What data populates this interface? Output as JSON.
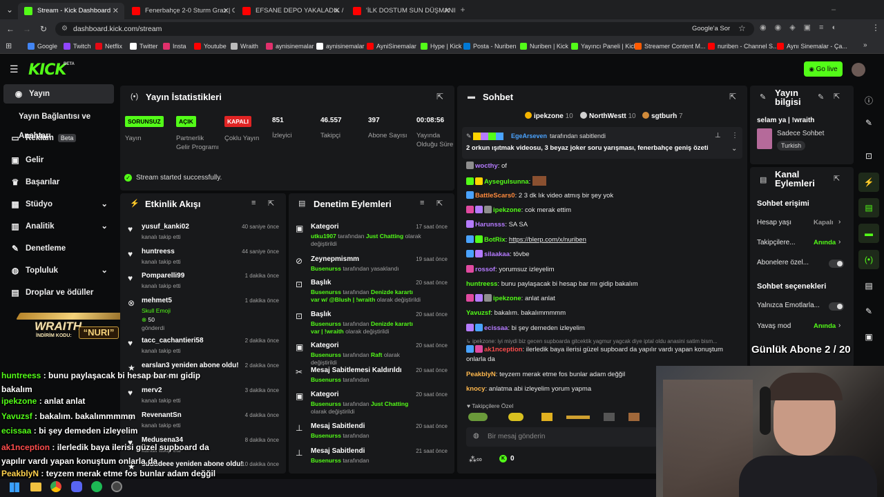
{
  "browser": {
    "tabs": [
      {
        "title": "Stream - Kick Dashboard",
        "fav": "#53fc18",
        "active": true
      },
      {
        "title": "Fenerbahçe 2-0 Sturm Graz | Gü",
        "fav": "#ff0000"
      },
      {
        "title": "EFSANE DEPO YAKALADIK / ŞT",
        "fav": "#ff0000"
      },
      {
        "title": "'İLK DOSTUM SUN DÜŞMANIM",
        "fav": "#ff0000"
      }
    ],
    "url": "dashboard.kick.com/stream",
    "google_btn": "Google'a Sor",
    "bookmarks": [
      {
        "label": "Google",
        "c": "#4285f4"
      },
      {
        "label": "Twitch",
        "c": "#9146ff"
      },
      {
        "label": "Netflix",
        "c": "#e50914"
      },
      {
        "label": "Twitter",
        "c": "#ffffff"
      },
      {
        "label": "Insta",
        "c": "#e1306c"
      },
      {
        "label": "Youtube",
        "c": "#ff0000"
      },
      {
        "label": "Wraith",
        "c": "#bbbbbb"
      },
      {
        "label": "aynisinemalar",
        "c": "#e1306c"
      },
      {
        "label": "aynisinemalar",
        "c": "#ffffff"
      },
      {
        "label": "AyniSinemalar",
        "c": "#ff0000"
      },
      {
        "label": "Hype | Kick",
        "c": "#53fc18"
      },
      {
        "label": "Posta - Nuriben",
        "c": "#0078d4"
      },
      {
        "label": "Nuriben | Kick",
        "c": "#53fc18"
      },
      {
        "label": "Yayıncı Paneli | Kick",
        "c": "#53fc18"
      },
      {
        "label": "Streamer Content M...",
        "c": "#ff5a00"
      },
      {
        "label": "nuriben - Channel S...",
        "c": "#ff0000"
      },
      {
        "label": "Aynı Sinemalar - Ça...",
        "c": "#ff0000"
      }
    ]
  },
  "kick": {
    "logo": "KICK",
    "beta": "BETA",
    "go_live": "Go live",
    "sidebar": [
      {
        "label": "Yayın",
        "icon": "broadcast-icon",
        "active": true
      },
      {
        "label": "Yayın Bağlantısı ve Anahtarı",
        "icon": ""
      },
      {
        "label": "Reklam",
        "icon": "ad-icon",
        "tag": "Beta"
      },
      {
        "label": "Gelir",
        "icon": "revenue-icon"
      },
      {
        "label": "Başarılar",
        "icon": "trophy-icon"
      },
      {
        "label": "Stüdyo",
        "icon": "studio-icon",
        "chev": true
      },
      {
        "label": "Analitik",
        "icon": "analytics-icon",
        "chev": true
      },
      {
        "label": "Denetleme",
        "icon": "moderation-icon"
      },
      {
        "label": "Topluluk",
        "icon": "community-icon",
        "chev": true
      },
      {
        "label": "Droplar ve ödüller",
        "icon": "drops-icon"
      }
    ],
    "stats": {
      "title": "Yayın İstatistikleri",
      "cells": [
        {
          "pill": "SORUNSUZ",
          "pill_color": "#53fc18",
          "label": "Yayın"
        },
        {
          "pill": "AÇIK",
          "pill_color": "#53fc18",
          "label": "Partnerlik Gelir Programı"
        },
        {
          "pill": "KAPALI",
          "pill_color": "#e02424",
          "label": "Çoklu Yayın"
        },
        {
          "value": "851",
          "label": "İzleyici"
        },
        {
          "value": "46.557",
          "label": "Takipçi"
        },
        {
          "value": "397",
          "label": "Abone Sayısı"
        },
        {
          "value": "00:08:56",
          "label": "Yayında Olduğu Süre"
        }
      ],
      "success": "Stream started successfully."
    },
    "activity": {
      "title": "Etkinlik Akışı",
      "items": [
        {
          "name": "yusuf_kanki02",
          "sub": "kanalı takip etti",
          "time": "40 saniye önce",
          "icon": "heart-icon"
        },
        {
          "name": "huntreess",
          "sub": "kanalı takip etti",
          "time": "44 saniye önce",
          "icon": "heart-icon"
        },
        {
          "name": "Pomparelli99",
          "sub": "kanalı takip etti",
          "time": "1 dakika önce",
          "icon": "heart-icon"
        },
        {
          "name": "mehmet5",
          "sub": "Skull Emoji",
          "sub2": "50",
          "sub3": "gönderdi",
          "time": "1 dakika önce",
          "icon": "kicks-icon"
        },
        {
          "name": "tacc_cachantieri58",
          "sub": "kanalı takip etti",
          "time": "2 dakika önce",
          "icon": "heart-icon"
        },
        {
          "name": "earslan3 yeniden abone oldu!",
          "sub": "3 aydır abone",
          "time": "2 dakika önce",
          "icon": "star-icon"
        },
        {
          "name": "merv2",
          "sub": "kanalı takip etti",
          "time": "3 dakika önce",
          "icon": "heart-icon"
        },
        {
          "name": "RevenantSn",
          "sub": "kanalı takip etti",
          "time": "4 dakika önce",
          "icon": "heart-icon"
        },
        {
          "name": "Medusena34",
          "sub": "kanalı takip etti",
          "time": "8 dakika önce",
          "icon": "heart-icon"
        },
        {
          "name": "suuudeee yeniden abone oldu!",
          "sub": "",
          "time": "10 dakika önce",
          "icon": "star-icon"
        }
      ]
    },
    "moderation": {
      "title": "Denetim Eylemleri",
      "items": [
        {
          "title": "Kategori",
          "user": "utku1907",
          "mid": "tarafından",
          "hl": "Just Chatting",
          "rest": "olarak değiştirildi",
          "time": "17 saat önce",
          "icon": "category-icon"
        },
        {
          "title": "Zeynepmismm",
          "user": "Busenurss",
          "mid": "tarafından yasaklandı",
          "hl": "",
          "rest": "",
          "time": "19 saat önce",
          "icon": "ban-icon"
        },
        {
          "title": "Başlık",
          "user": "Busenurss",
          "mid": "tarafından",
          "hl": "Denizde karartı var w/ @Blush | !wraith",
          "rest": "olarak değiştirildi",
          "time": "20 saat önce",
          "icon": "title-icon"
        },
        {
          "title": "Başlık",
          "user": "Busenurss",
          "mid": "tarafından",
          "hl": "Denizde karartı var | !wraith",
          "rest": "olarak değiştirildi",
          "time": "20 saat önce",
          "icon": "title-icon"
        },
        {
          "title": "Kategori",
          "user": "Busenurss",
          "mid": "tarafından",
          "hl": "Raft",
          "rest": "olarak değiştirildi",
          "time": "20 saat önce",
          "icon": "category-icon"
        },
        {
          "title": "Mesaj Sabitlemesi Kaldırıldı",
          "user": "Busenurss",
          "mid": "tarafından",
          "hl": "",
          "rest": "",
          "time": "20 saat önce",
          "icon": "unpin-icon"
        },
        {
          "title": "Kategori",
          "user": "Busenurss",
          "mid": "tarafından",
          "hl": "Just Chatting",
          "rest": "olarak değiştirildi",
          "time": "20 saat önce",
          "icon": "category-icon"
        },
        {
          "title": "Mesaj Sabitlendi",
          "user": "Busenurss",
          "mid": "tarafından",
          "hl": "",
          "rest": "",
          "time": "20 saat önce",
          "icon": "pin-icon"
        },
        {
          "title": "Mesaj Sabitlendi",
          "user": "Busenurss",
          "mid": "tarafından",
          "hl": "",
          "rest": "",
          "time": "21 saat önce",
          "icon": "pin-icon"
        }
      ]
    },
    "chat": {
      "title": "Sohbet",
      "gifters": [
        {
          "name": "ipekzone",
          "n": "10"
        },
        {
          "name": "NorthWestt",
          "n": "10"
        },
        {
          "name": "sgtburh",
          "n": "7"
        }
      ],
      "pinned_by": "EgeArseven",
      "pinned_by_text": "tarafından sabitlendi",
      "pinned_msg": "2 orkun ışıtmak videosu, 3 beyaz joker soru yarışması, fenerbahçe geniş özeti",
      "messages": [
        {
          "user": "wocthy",
          "color": "#b57bff",
          "text": "of"
        },
        {
          "user": "Aysegulsunna",
          "color": "#53fc18",
          "text": ""
        },
        {
          "user": "BattleScars0",
          "color": "#ff8a3d",
          "text": "2 3 dk lık video atmış bir şey yok"
        },
        {
          "user": "ipekzone",
          "color": "#53fc18",
          "text": "cok merak ettim"
        },
        {
          "user": "Harunsss",
          "color": "#b57bff",
          "text": "SA SA"
        },
        {
          "user": "BotRix",
          "color": "#53fc18",
          "text": "https://blerp.com/x/nuriben"
        },
        {
          "user": "silaakaa",
          "color": "#b57bff",
          "text": "tövbe"
        },
        {
          "user": "rossof",
          "color": "#b57bff",
          "text": "yorumsuz izleyelim"
        },
        {
          "user": "huntreess",
          "color": "#53fc18",
          "text": "bunu paylaşacak bi hesap bar mı gidip bakalım"
        },
        {
          "user": "ipekzone",
          "color": "#53fc18",
          "text": "anlat anlat"
        },
        {
          "user": "Yavuzsf",
          "color": "#53fc18",
          "text": "bakalım. bakalımmmmm"
        },
        {
          "user": "ecissaa",
          "color": "#b57bff",
          "text": "bi şey demeden izleyelim"
        },
        {
          "user": "ak1nception",
          "color": "#ff4d4d",
          "text": "ilerledik baya ilerisi güzel supboard da yapılır vardı yapan konuştum onlarla da"
        },
        {
          "user": "PeakblyN",
          "color": "#ffb84d",
          "text": "teyzem merak etme fos bunlar adam değğil"
        },
        {
          "user": "knocy",
          "color": "#ffb84d",
          "text": "anlatma abi izleyelim yorum yapma"
        }
      ],
      "reply_ctx": "ipekzone: iyi miydi biz gecen supboarda gitcektik yagmur yagcak diye iptal oldu anasini satim bism...",
      "follower_label": "Takipçilere Özel",
      "input_placeholder": "Bir mesaj gönderin",
      "kicks": "0"
    },
    "info": {
      "title": "Yayın bilgisi",
      "stream_title": "selam ya | !wraith",
      "category": "Sadece Sohbet",
      "language": "Turkish"
    },
    "channel": {
      "title": "Kanal Eylemleri",
      "chat_access": "Sohbet erişimi",
      "rows": [
        {
          "label": "Hesap yaşı",
          "value": "Kapalı",
          "vcolor": "#9a9a9a"
        },
        {
          "label": "Takipçilere...",
          "value": "Anında",
          "vcolor": "#53fc18"
        },
        {
          "label": "Abonelere özel...",
          "value": "",
          "toggle": true
        }
      ],
      "options": "Sohbet seçenekleri",
      "rows2": [
        {
          "label": "Yalnızca Emotlarla...",
          "value": "",
          "toggle": true
        },
        {
          "label": "Yavaş mod",
          "value": "Anında",
          "vcolor": "#53fc18"
        }
      ]
    }
  },
  "overlay": {
    "sponsor_brand": "WRAITH.",
    "sponsor_code_label": "İNDİRİM KODU:",
    "sponsor_code": "NURI",
    "daily_sub": "Günlük Abone 2 / 20",
    "chat": [
      {
        "user": "huntreess",
        "color": "#53fc18",
        "text": "bunu paylaşacak bi hesap bar mı gidip bakalım"
      },
      {
        "user": "ipekzone",
        "color": "#53fc18",
        "text": "anlat anlat"
      },
      {
        "user": "Yavuzsf",
        "color": "#53fc18",
        "text": "bakalım. bakalımmmmm"
      },
      {
        "user": "ecissaa",
        "color": "#53fc18",
        "text": "bi şey demeden izleyelim"
      },
      {
        "user": "ak1nception",
        "color": "#ff4d4d",
        "text": "ilerledik baya ilerisi güzel supboard da yapılır vardı yapan konuştum onlarla da"
      },
      {
        "user": "PeakblyN",
        "color": "#ffd24d",
        "text": "teyzem merak etme fos bunlar adam değğil"
      }
    ]
  }
}
